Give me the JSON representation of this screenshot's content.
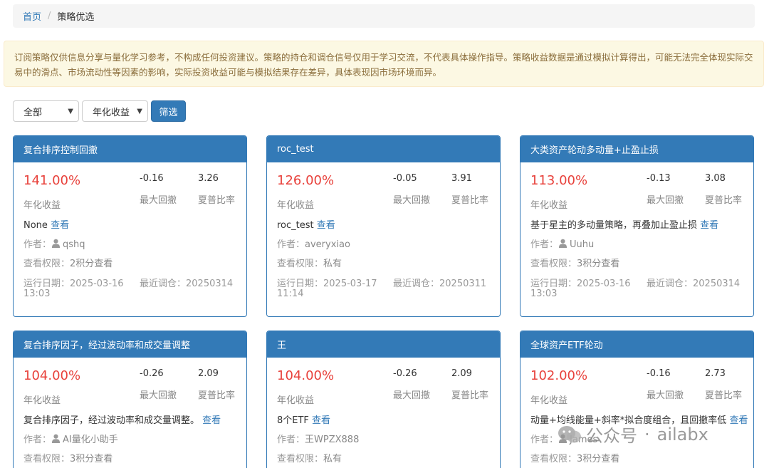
{
  "breadcrumb": {
    "home": "首页",
    "separator": "/",
    "current": "策略优选"
  },
  "notice": "订阅策略仅供信息分享与量化学习参考，不构成任何投资建议。策略的持仓和调仓信号仅用于学习交流，不代表具体操作指导。策略收益数据是通过模拟计算得出，可能无法完全体现实际交易中的滑点、市场流动性等因素的影响，实际投资收益可能与模拟结果存在差异，具体表现因市场环境而异。",
  "filters": {
    "category": "全部",
    "sort": "年化收益",
    "button": "筛选"
  },
  "labels": {
    "annual_return": "年化收益",
    "max_drawdown": "最大回撤",
    "sharpe": "夏普比率",
    "view": "查看",
    "author": "作者：",
    "permission": "查看权限：",
    "run_date": "运行日期：",
    "last_rebalance": "最近调仓："
  },
  "cards": [
    {
      "title": "复合排序控制回撤",
      "return": "141.00%",
      "drawdown": "-0.16",
      "sharpe": "3.26",
      "desc": "None",
      "author": "qshq",
      "author_icon": "user-icon",
      "permission": "2积分查看",
      "run_date": "2025-03-16",
      "run_time": "13:03",
      "rebalance": "20250314"
    },
    {
      "title": "roc_test",
      "return": "126.00%",
      "drawdown": "-0.05",
      "sharpe": "3.91",
      "desc": "roc_test",
      "author": "averyxiao",
      "author_icon": "",
      "permission": "私有",
      "run_date": "2025-03-17",
      "run_time": "11:14",
      "rebalance": "20250311"
    },
    {
      "title": "大类资产轮动多动量+止盈止损",
      "return": "113.00%",
      "drawdown": "-0.13",
      "sharpe": "3.08",
      "desc": "基于星主的多动量策略，再叠加止盈止损",
      "author": "Uuhu",
      "author_icon": "user-icon",
      "permission": "3积分查看",
      "run_date": "2025-03-16",
      "run_time": "13:03",
      "rebalance": "20250314"
    },
    {
      "title": "复合排序因子，经过波动率和成交量调整",
      "return": "104.00%",
      "drawdown": "-0.26",
      "sharpe": "2.09",
      "desc": "复合排序因子，经过波动率和成交量调整。",
      "author": "AI量化小助手",
      "author_icon": "user-icon",
      "permission": "3积分查看"
    },
    {
      "title": "王",
      "return": "104.00%",
      "drawdown": "-0.26",
      "sharpe": "2.09",
      "desc": "8个ETF",
      "author": "王WPZX888",
      "author_icon": "",
      "permission": "私有"
    },
    {
      "title": "全球资产ETF轮动",
      "return": "102.00%",
      "drawdown": "-0.16",
      "sharpe": "2.73",
      "desc": "动量+均线能量+斜率*拟合度组合，且回撤率低",
      "author": "James",
      "author_icon": "user-icon",
      "permission": "3积分查看"
    }
  ],
  "watermark": {
    "text": "公众号",
    "separator": "·",
    "account": "ailabx"
  }
}
